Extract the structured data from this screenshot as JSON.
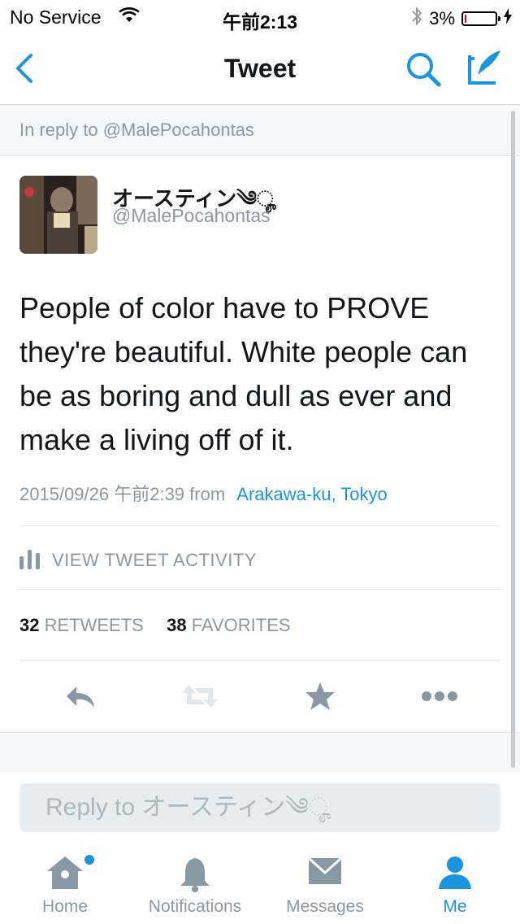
{
  "status_bar": {
    "carrier": "No Service",
    "time": "午前2:13",
    "battery": "3%",
    "battery_level": 0.03
  },
  "nav": {
    "title": "Tweet"
  },
  "reply_banner": "In reply to @MalePocahontas",
  "author": {
    "display_name": "オースティン༄ೄ",
    "handle": "@MalePocahontas"
  },
  "tweet": {
    "text": "People of color have to PROVE they're beautiful. White people can be as boring and dull as ever and make a living off of it.",
    "timestamp": "2015/09/26 午前2:39",
    "from_label": "from",
    "location": "Arakawa-ku, Tokyo"
  },
  "activity_label": "VIEW TWEET ACTIVITY",
  "stats": {
    "retweets_count": "32",
    "retweets_label": "RETWEETS",
    "favorites_count": "38",
    "favorites_label": "FAVORITES"
  },
  "reply_placeholder": "Reply to オースティン༄ೄ",
  "tabs": [
    {
      "label": "Home",
      "icon": "home-icon"
    },
    {
      "label": "Notifications",
      "icon": "bell-icon"
    },
    {
      "label": "Messages",
      "icon": "envelope-icon"
    },
    {
      "label": "Me",
      "icon": "person-icon"
    }
  ],
  "colors": {
    "accent": "#1b95e0",
    "muted": "#8899a6",
    "text": "#14171a"
  }
}
